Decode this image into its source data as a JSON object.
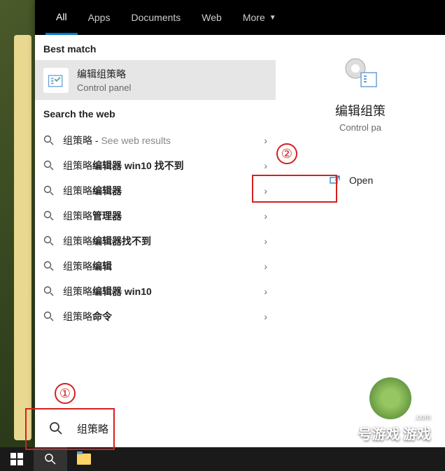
{
  "tabs": {
    "all": "All",
    "apps": "Apps",
    "documents": "Documents",
    "web": "Web",
    "more": "More"
  },
  "sections": {
    "best_match": "Best match",
    "search_web": "Search the web"
  },
  "best_match": {
    "title": "编辑组策略",
    "subtitle": "Control panel"
  },
  "web_results": [
    {
      "prefix": "组策略",
      "bold": "",
      "suffix": " - ",
      "grey": "See web results"
    },
    {
      "prefix": "组策略",
      "bold": "编辑器 win10 找不到",
      "suffix": "",
      "grey": ""
    },
    {
      "prefix": "组策略",
      "bold": "编辑器",
      "suffix": "",
      "grey": ""
    },
    {
      "prefix": "组策略",
      "bold": "管理器",
      "suffix": "",
      "grey": ""
    },
    {
      "prefix": "组策略",
      "bold": "编辑器找不到",
      "suffix": "",
      "grey": ""
    },
    {
      "prefix": "组策略",
      "bold": "编辑",
      "suffix": "",
      "grey": ""
    },
    {
      "prefix": "组策略",
      "bold": "编辑器 win10",
      "suffix": "",
      "grey": ""
    },
    {
      "prefix": "组策略",
      "bold": "命令",
      "suffix": "",
      "grey": ""
    }
  ],
  "right_panel": {
    "title": "编辑组策",
    "subtitle": "Control pa",
    "open_label": "Open"
  },
  "search": {
    "value": "组策略"
  },
  "annotations": {
    "one": "①",
    "two": "②"
  },
  "watermark": {
    "url": ".com",
    "name": "号游戏",
    "sub": "游戏"
  }
}
